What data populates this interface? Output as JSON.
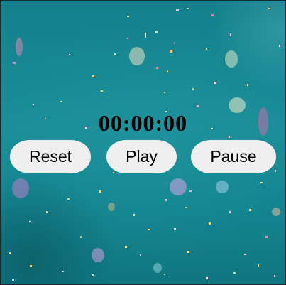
{
  "stopwatch": {
    "time_display": "00:00:00",
    "reset_label": "Reset",
    "play_label": "Play",
    "pause_label": "Pause"
  },
  "colors": {
    "background": "#16858f",
    "button_bg": "#efefef",
    "text": "#000000"
  }
}
